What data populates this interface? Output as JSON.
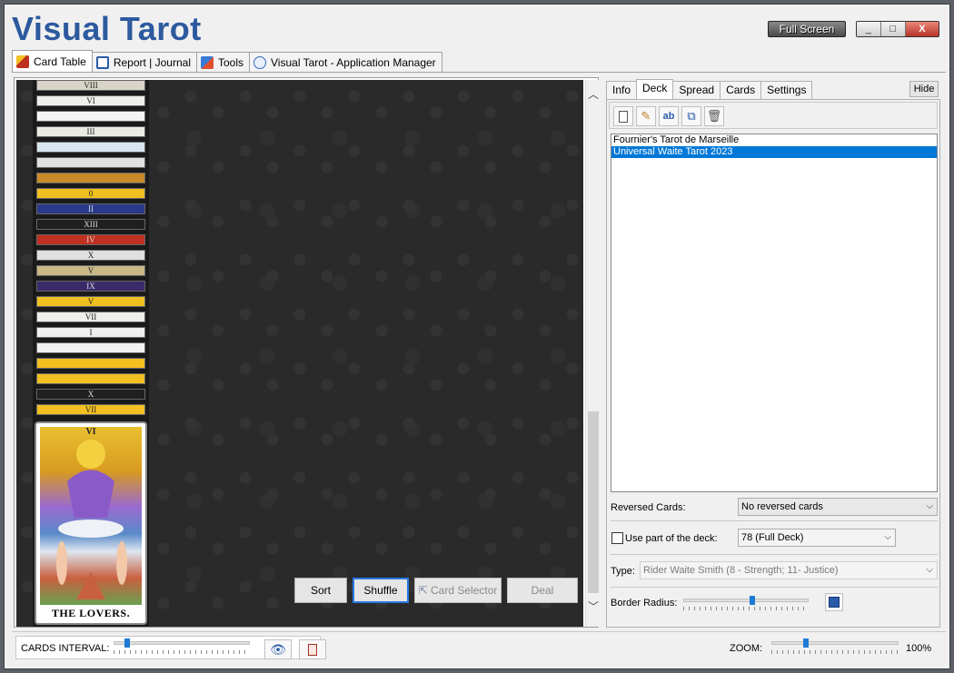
{
  "app": {
    "title": "Visual Tarot",
    "fullscreen_label": "Full Screen",
    "window_controls": [
      "_",
      "□",
      "X"
    ]
  },
  "main_tabs": [
    {
      "label": "Card Table",
      "icon": "wand-icon",
      "active": true
    },
    {
      "label": "Report | Journal",
      "icon": "report-icon"
    },
    {
      "label": "Tools",
      "icon": "tools-icon"
    },
    {
      "label": "Visual Tarot - Application Manager",
      "icon": "info-icon"
    }
  ],
  "deck_stack": {
    "strips": [
      "VIII",
      "VI",
      "",
      "III",
      "",
      "",
      "",
      "0",
      "II",
      "XIII",
      "IV",
      "X",
      "V",
      "IX",
      "V",
      "VII",
      "I",
      "",
      "",
      "",
      "X",
      "VII"
    ],
    "strip_colors": [
      "#d9d4c8",
      "#eeeeea",
      "#f4f4f4",
      "#ebebe6",
      "#d8e6f0",
      "#e0e0e0",
      "#c98a2a",
      "#f0c020",
      "#2a3a8a",
      "#202020",
      "#c03020",
      "#e0e0e0",
      "#c8b888",
      "#3a2a6a",
      "#f0c020",
      "#eeeeea",
      "#f0f0f0",
      "#f0f0f0",
      "#f4c020",
      "#f2c020",
      "#202020",
      "#f2c020"
    ],
    "top_card": {
      "number": "VI",
      "caption": "THE LOVERS."
    }
  },
  "table_buttons": {
    "sort": "Sort",
    "shuffle": "Shuffle",
    "card_selector": "Card Selector",
    "deal": "Deal"
  },
  "right_tabs": [
    {
      "label": "Info"
    },
    {
      "label": "Deck",
      "active": true
    },
    {
      "label": "Spread"
    },
    {
      "label": "Cards"
    },
    {
      "label": "Settings"
    }
  ],
  "hide_label": "Hide",
  "toolbar_icons": [
    "new-deck-icon",
    "edit-deck-icon",
    "rename-deck-icon",
    "copy-deck-icon",
    "delete-deck-icon"
  ],
  "decks": [
    {
      "name": "Fournier's Tarot de Marseille",
      "selected": false
    },
    {
      "name": "Universal Waite Tarot 2023",
      "selected": true
    }
  ],
  "reversed_cards": {
    "label": "Reversed Cards:",
    "value": "No reversed cards"
  },
  "use_part": {
    "label": "Use part of the deck:",
    "checked": false,
    "value": "78 (Full Deck)"
  },
  "type": {
    "label": "Type:",
    "value": "Rider Waite Smith (8 - Strength; 11- Justice)"
  },
  "border_radius": {
    "label": "Border Radius:",
    "level": 0.55
  },
  "status": {
    "cards_interval_label": "CARDS INTERVAL:",
    "cards_interval_level": 0.1,
    "zoom_label": "ZOOM:",
    "zoom_value": "100%",
    "zoom_level": 0.27
  }
}
